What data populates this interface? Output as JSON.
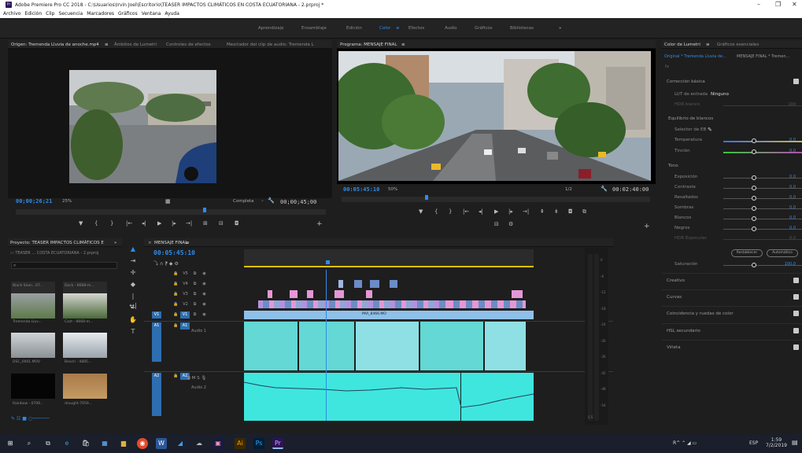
{
  "app": {
    "title": "Adobe Premiere Pro CC 2018 - C:\\Usuarios\\Irvin Joel\\Escritorio\\TEASER IMPACTOS CLIMÁTICOS EN COSTA ECUATORIANA - 2.prproj *",
    "logo": "Pr"
  },
  "menu": [
    "Archivo",
    "Edición",
    "Clip",
    "Secuencia",
    "Marcadores",
    "Gráficos",
    "Ventana",
    "Ayuda"
  ],
  "workspaces": [
    "Aprendizaje",
    "Ensamblaje",
    "Edición",
    "Color",
    "Efectos",
    "Audio",
    "Gráficos",
    "Bibliotecas"
  ],
  "workspaces_more": "»",
  "workspace_menu_icon": "≡",
  "active_workspace": "Color",
  "source": {
    "tabs": [
      "Origen: Tremenda Lluvia de anoche.mp4",
      "Ámbitos de Lumetri",
      "Controles de efectos",
      "Mezclador del clip de audio: Tremenda L"
    ],
    "tab_menu": "≡",
    "timecode": "00;00;26;21",
    "zoom": "25%",
    "fit": "Completa",
    "duration": "00;00;45;00",
    "fit_caret": "⌄"
  },
  "program": {
    "tab": "Programa: MENSAJE FINAL",
    "tab_menu": "≡",
    "timecode": "00:05:45:10",
    "zoom": "50%",
    "quality": "1/2",
    "duration": "00:02:40:00"
  },
  "transport": {
    "marker": "▼",
    "in": "{",
    "out": "}",
    "goin": "|←",
    "back": "◂|",
    "play": "▶",
    "fwd": "|▸",
    "goout": "→|",
    "insert": "⊞",
    "overwrite": "⊟",
    "export": "◘",
    "add": "+",
    "lift": "⇞",
    "extract": "⇟",
    "compare": "⧉",
    "settings": "⚙"
  },
  "lumetri": {
    "tabs": [
      "Color de Lumetri",
      "Gráficos esenciales"
    ],
    "tab_menu": "≡",
    "subtitle_left": "Original * Tremenda Lluvia de...",
    "subtitle_right": "MENSAJE FINAL * Tremen...",
    "fx": "fx",
    "basic": "Corrección básica",
    "lut_label": "LUT de entrada",
    "lut_value": "Ninguno",
    "hdr_label": "HDR blanco",
    "hdr_value": "100",
    "wb": "Equilibrio de blancos",
    "wb_selector": "Selector de EB",
    "temp": "Temperatura",
    "temp_val": "0,0",
    "tint": "Tinción",
    "tint_val": "0,0",
    "tone": "Tono",
    "tone_rows": [
      {
        "l": "Exposición",
        "v": "0,0"
      },
      {
        "l": "Contraste",
        "v": "0,0"
      },
      {
        "l": "Resaltados",
        "v": "0,0"
      },
      {
        "l": "Sombras",
        "v": "0,0"
      },
      {
        "l": "Blancos",
        "v": "0,0"
      },
      {
        "l": "Negros",
        "v": "0,0"
      },
      {
        "l": "HDR Especular",
        "v": "0,0"
      }
    ],
    "reset": "Restablecer",
    "auto": "Automático",
    "sat": "Saturación",
    "sat_val": "100,0",
    "sections": [
      "Creativo",
      "Curvas",
      "Coincidencia y ruedas de color",
      "HSL secundario",
      "Viñeta"
    ]
  },
  "project": {
    "tab": "Proyecto: TEASER IMPACTOS CLIMÁTICOS E",
    "tab_more": "»",
    "bin": "TEASER ... COSTA ECUATORIANA - 2.prproj",
    "items": [
      {
        "name": "Black Sean...07...",
        "dur": "4;07"
      },
      {
        "name": "Dock - 8668-m...",
        "dur": "10;04"
      },
      {
        "name": "Tremenda Lluv...",
        "dur": "45;00"
      },
      {
        "name": "Cast - 8668-m...",
        "dur": "15;04"
      },
      {
        "name": "DSC_0001.MOV",
        "dur": "28;01"
      },
      {
        "name": "Beach - 4885...",
        "dur": "17;04"
      },
      {
        "name": "Rainbow - 0706...",
        "dur": "10;04"
      },
      {
        "name": "drought-7059...",
        "dur": "3;04"
      }
    ]
  },
  "timeline": {
    "tab": "MENSAJE FINAL",
    "tab_menu": "≡",
    "timecode": "00:05:45:10",
    "tracks": [
      "V5",
      "V4",
      "V3",
      "V2",
      "V1",
      "A1",
      "A2"
    ],
    "audio1": "Audio 1",
    "audio2": "Audio 2",
    "clip_label": "MVI_8466.MO"
  },
  "meter_scale": [
    "0",
    "-6",
    "-12",
    "-18",
    "-24",
    "-30",
    "-36",
    "-42",
    "-48",
    "-54",
    "dB"
  ],
  "meter_labels": [
    "S",
    "S"
  ],
  "taskbar": {
    "time": "1:59",
    "date": "7/2/2019",
    "lang": "ESP"
  }
}
